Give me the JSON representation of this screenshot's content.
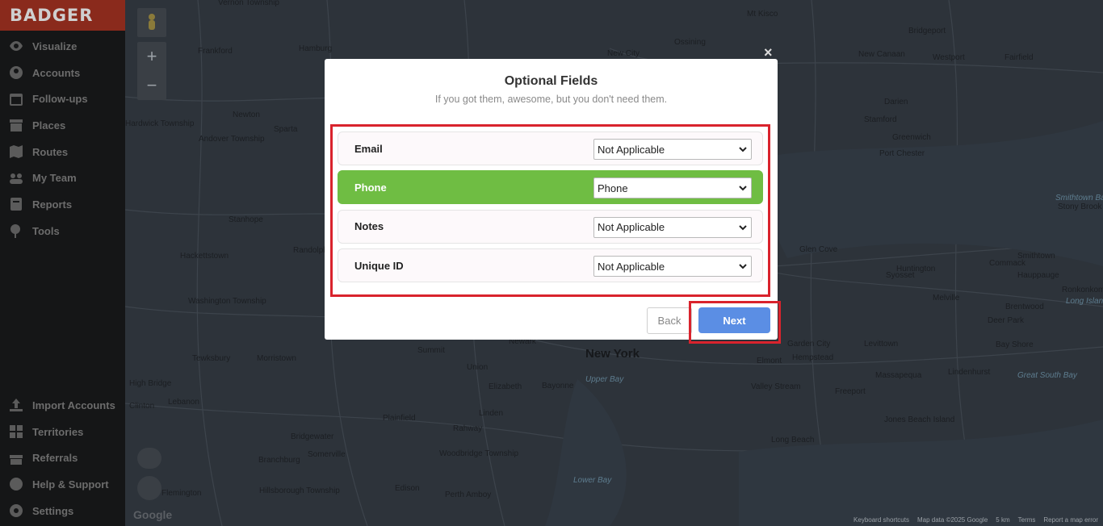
{
  "brand": "BADGER",
  "nav_top": [
    {
      "label": "Visualize",
      "icon": "eye-icon"
    },
    {
      "label": "Accounts",
      "icon": "person-icon"
    },
    {
      "label": "Follow-ups",
      "icon": "calendar-icon"
    },
    {
      "label": "Places",
      "icon": "store-icon"
    },
    {
      "label": "Routes",
      "icon": "map-icon"
    },
    {
      "label": "My Team",
      "icon": "team-icon"
    },
    {
      "label": "Reports",
      "icon": "report-icon"
    },
    {
      "label": "Tools",
      "icon": "pin-icon"
    }
  ],
  "nav_bottom": [
    {
      "label": "Import Accounts",
      "icon": "upload-icon"
    },
    {
      "label": "Territories",
      "icon": "grid-icon"
    },
    {
      "label": "Referrals",
      "icon": "gift-icon"
    },
    {
      "label": "Help & Support",
      "icon": "help-icon"
    },
    {
      "label": "Settings",
      "icon": "gear-icon"
    }
  ],
  "modal": {
    "title": "Optional Fields",
    "subtitle": "If you got them, awesome, but you don't need them.",
    "close": "×",
    "fields": [
      {
        "label": "Email",
        "value": "Not Applicable",
        "active": false
      },
      {
        "label": "Phone",
        "value": "Phone",
        "active": true
      },
      {
        "label": "Notes",
        "value": "Not Applicable",
        "active": false
      },
      {
        "label": "Unique ID",
        "value": "Not Applicable",
        "active": false
      }
    ],
    "back_label": "Back",
    "next_label": "Next"
  },
  "map": {
    "places": [
      {
        "name": "Vernon Township",
        "cls": ""
      },
      {
        "name": "Mt Kisco",
        "cls": ""
      },
      {
        "name": "Bridgeport",
        "cls": ""
      },
      {
        "name": "Frankford",
        "cls": ""
      },
      {
        "name": "Hamburg",
        "cls": ""
      },
      {
        "name": "New City",
        "cls": ""
      },
      {
        "name": "Ossining",
        "cls": ""
      },
      {
        "name": "New Canaan",
        "cls": ""
      },
      {
        "name": "Westport",
        "cls": ""
      },
      {
        "name": "Fairfield",
        "cls": ""
      },
      {
        "name": "Darien",
        "cls": ""
      },
      {
        "name": "Stamford",
        "cls": ""
      },
      {
        "name": "Newton",
        "cls": ""
      },
      {
        "name": "Sparta",
        "cls": ""
      },
      {
        "name": "Andover Township",
        "cls": ""
      },
      {
        "name": "Greenwich",
        "cls": ""
      },
      {
        "name": "Port Chester",
        "cls": ""
      },
      {
        "name": "Hardwick Township",
        "cls": ""
      },
      {
        "name": "Stanhope",
        "cls": ""
      },
      {
        "name": "Randolph",
        "cls": ""
      },
      {
        "name": "Hackettstown",
        "cls": ""
      },
      {
        "name": "Washington Township",
        "cls": ""
      },
      {
        "name": "Glen Cove",
        "cls": ""
      },
      {
        "name": "Huntington",
        "cls": ""
      },
      {
        "name": "Syosset",
        "cls": ""
      },
      {
        "name": "Commack",
        "cls": ""
      },
      {
        "name": "Smithtown",
        "cls": ""
      },
      {
        "name": "Hauppauge",
        "cls": ""
      },
      {
        "name": "Stony Brook",
        "cls": ""
      },
      {
        "name": "Ronkonkoma",
        "cls": ""
      },
      {
        "name": "Long Island",
        "cls": "water"
      },
      {
        "name": "Smithtown Bay",
        "cls": "water"
      },
      {
        "name": "Melville",
        "cls": ""
      },
      {
        "name": "Brentwood",
        "cls": ""
      },
      {
        "name": "Deer Park",
        "cls": ""
      },
      {
        "name": "Tewksbury",
        "cls": ""
      },
      {
        "name": "High Bridge",
        "cls": ""
      },
      {
        "name": "Clinton",
        "cls": ""
      },
      {
        "name": "Lebanon",
        "cls": ""
      },
      {
        "name": "Morristown",
        "cls": ""
      },
      {
        "name": "Summit",
        "cls": ""
      },
      {
        "name": "Union",
        "cls": ""
      },
      {
        "name": "Newark",
        "cls": ""
      },
      {
        "name": "New York",
        "cls": "big"
      },
      {
        "name": "Elmont",
        "cls": ""
      },
      {
        "name": "Garden City",
        "cls": ""
      },
      {
        "name": "Hempstead",
        "cls": ""
      },
      {
        "name": "Levittown",
        "cls": ""
      },
      {
        "name": "Bay Shore",
        "cls": ""
      },
      {
        "name": "Lindenhurst",
        "cls": ""
      },
      {
        "name": "Massapequa",
        "cls": ""
      },
      {
        "name": "Great South Bay",
        "cls": "water"
      },
      {
        "name": "Elizabeth",
        "cls": ""
      },
      {
        "name": "Bayonne",
        "cls": ""
      },
      {
        "name": "Upper Bay",
        "cls": "water"
      },
      {
        "name": "Valley Stream",
        "cls": ""
      },
      {
        "name": "Freeport",
        "cls": ""
      },
      {
        "name": "Plainfield",
        "cls": ""
      },
      {
        "name": "Rahway",
        "cls": ""
      },
      {
        "name": "Linden",
        "cls": ""
      },
      {
        "name": "Bridgewater",
        "cls": ""
      },
      {
        "name": "Somerville",
        "cls": ""
      },
      {
        "name": "Branchburg",
        "cls": ""
      },
      {
        "name": "Woodbridge Township",
        "cls": ""
      },
      {
        "name": "Jones Beach Island",
        "cls": ""
      },
      {
        "name": "Long Beach",
        "cls": ""
      },
      {
        "name": "Hillsborough Township",
        "cls": ""
      },
      {
        "name": "Edison",
        "cls": ""
      },
      {
        "name": "Perth Amboy",
        "cls": ""
      },
      {
        "name": "Lower Bay",
        "cls": "water"
      },
      {
        "name": "Flemington",
        "cls": ""
      }
    ],
    "footer": [
      "Keyboard shortcuts",
      "Map data ©2025 Google",
      "5 km",
      "Terms",
      "Report a map error"
    ],
    "google": "Google",
    "zoom_in": "+",
    "zoom_out": "−"
  },
  "colors": {
    "accent_next": "#5b8ee4",
    "active_row": "#6fbd43",
    "highlight": "#d9232d",
    "brand_bg": "#8a2a1c"
  }
}
